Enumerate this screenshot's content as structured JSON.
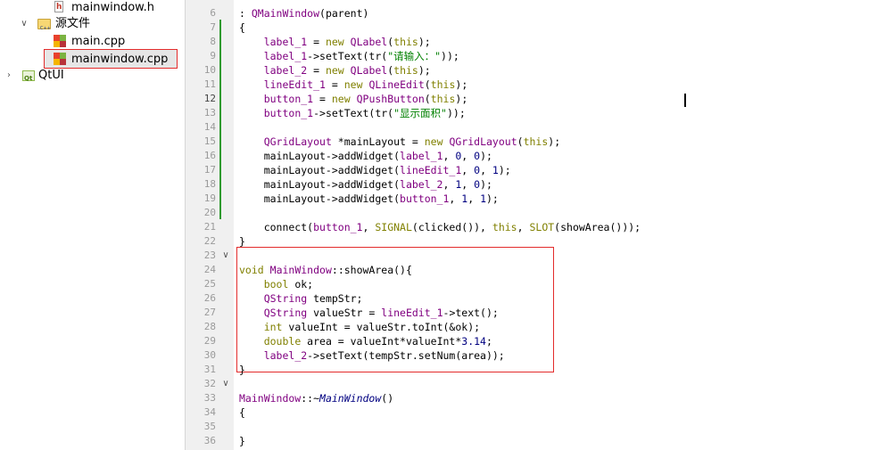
{
  "tree": {
    "items": [
      {
        "label": "mainwindow.h",
        "icon": "header-file-icon"
      },
      {
        "label": "源文件",
        "icon": "source-folder-icon"
      },
      {
        "label": "main.cpp",
        "icon": "cpp-file-icon"
      },
      {
        "label": "mainwindow.cpp",
        "icon": "cpp-file-icon",
        "selected": true
      },
      {
        "label": "QtUI",
        "icon": "qt-project-icon"
      }
    ]
  },
  "editor": {
    "line_numbers": [
      "6",
      "7",
      "8",
      "9",
      "10",
      "11",
      "12",
      "13",
      "14",
      "15",
      "16",
      "17",
      "18",
      "19",
      "20",
      "21",
      "22",
      "23",
      "24",
      "25",
      "26",
      "27",
      "28",
      "29",
      "30",
      "31",
      "32",
      "33",
      "34",
      "35",
      "36"
    ],
    "current_line": "12",
    "lines": [
      ": QMainWindow(parent)",
      "{",
      "    label_1 = new QLabel(this);",
      "    label_1->setText(tr(\"请输入：\"));",
      "    label_2 = new QLabel(this);",
      "    lineEdit_1 = new QLineEdit(this);",
      "    button_1 = new QPushButton(this);",
      "    button_1->setText(tr(\"显示面积\"));",
      "",
      "    QGridLayout *mainLayout = new QGridLayout(this);",
      "    mainLayout->addWidget(label_1, 0, 0);",
      "    mainLayout->addWidget(lineEdit_1, 0, 1);",
      "    mainLayout->addWidget(label_2, 1, 0);",
      "    mainLayout->addWidget(button_1, 1, 1);",
      "",
      "    connect(button_1, SIGNAL(clicked()), this, SLOT(showArea()));",
      "}",
      "",
      "void MainWindow::showArea(){",
      "    bool ok;",
      "    QString tempStr;",
      "    QString valueStr = lineEdit_1->text();",
      "    int valueInt = valueStr.toInt(&ok);",
      "    double area = valueInt*valueInt*3.14;",
      "    label_2->setText(tempStr.setNum(area));",
      "}",
      "",
      "MainWindow::~MainWindow()",
      "{",
      "",
      "}"
    ]
  },
  "colors": {
    "highlight_border": "#e32c2c",
    "keyword": "#808000",
    "class": "#800080",
    "string": "#008000",
    "number": "#000080",
    "change_marker": "#2f9a2f"
  }
}
